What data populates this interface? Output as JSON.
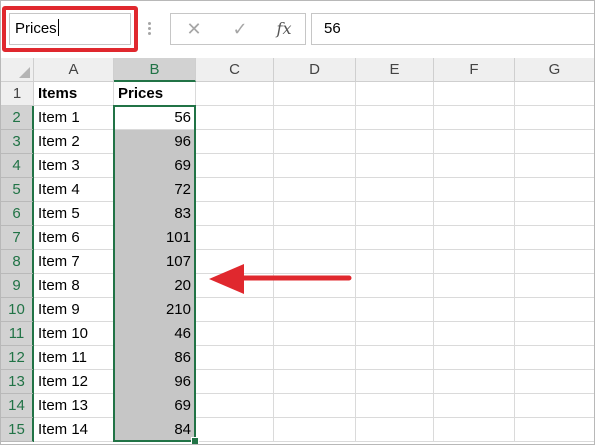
{
  "formula_bar": {
    "name_box": "Prices",
    "cancel_icon": "✕",
    "enter_icon": "✓",
    "fx_label": "fx",
    "formula_value": "56"
  },
  "columns": [
    "A",
    "B",
    "C",
    "D",
    "E",
    "F",
    "G"
  ],
  "rows": [
    "1",
    "2",
    "3",
    "4",
    "5",
    "6",
    "7",
    "8",
    "9",
    "10",
    "11",
    "12",
    "13",
    "14",
    "15"
  ],
  "headers": {
    "A": "Items",
    "B": "Prices"
  },
  "items": [
    {
      "name": "Item 1",
      "price": "56"
    },
    {
      "name": "Item 2",
      "price": "96"
    },
    {
      "name": "Item 3",
      "price": "69"
    },
    {
      "name": "Item 4",
      "price": "72"
    },
    {
      "name": "Item 5",
      "price": "83"
    },
    {
      "name": "Item 6",
      "price": "101"
    },
    {
      "name": "Item 7",
      "price": "107"
    },
    {
      "name": "Item 8",
      "price": "20"
    },
    {
      "name": "Item 9",
      "price": "210"
    },
    {
      "name": "Item 10",
      "price": "46"
    },
    {
      "name": "Item 11",
      "price": "86"
    },
    {
      "name": "Item 12",
      "price": "96"
    },
    {
      "name": "Item 13",
      "price": "69"
    },
    {
      "name": "Item 14",
      "price": "84"
    }
  ],
  "colors": {
    "annotation_red": "#e0282e",
    "selection_green": "#217346",
    "selection_fill": "#c6c6c6"
  }
}
